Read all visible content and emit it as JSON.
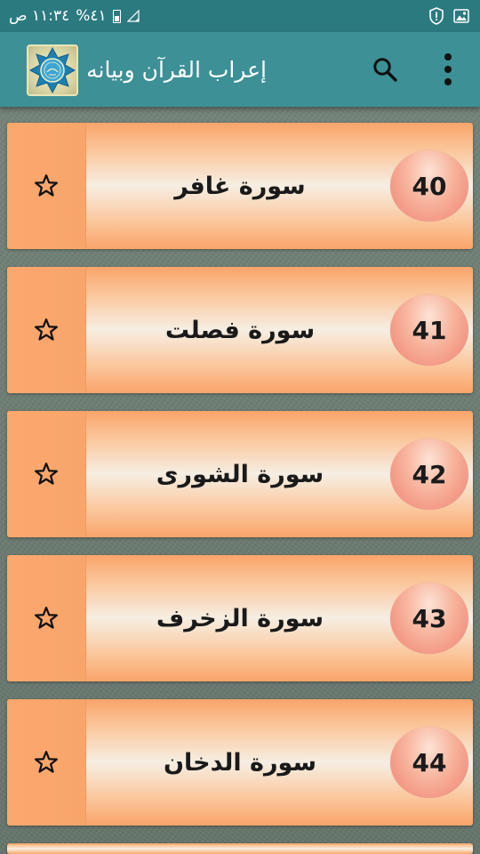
{
  "status_bar": {
    "time": "١١:٣٤ ص",
    "battery": "%٤١"
  },
  "toolbar": {
    "title": "إعراب القرآن وبيانه",
    "logo_icon": "app-logo-icon",
    "search_icon": "search-icon",
    "menu_icon": "more-vert-icon"
  },
  "colors": {
    "status_bar": "#2b7a80",
    "toolbar": "#3c9096",
    "card_edge": "#f9a46a",
    "number_circle": "#ef8074"
  },
  "surahs": [
    {
      "number": "40",
      "name": "سورة غافر"
    },
    {
      "number": "41",
      "name": "سورة فصلت"
    },
    {
      "number": "42",
      "name": "سورة الشورى"
    },
    {
      "number": "43",
      "name": "سورة الزخرف"
    },
    {
      "number": "44",
      "name": "سورة الدخان"
    }
  ]
}
